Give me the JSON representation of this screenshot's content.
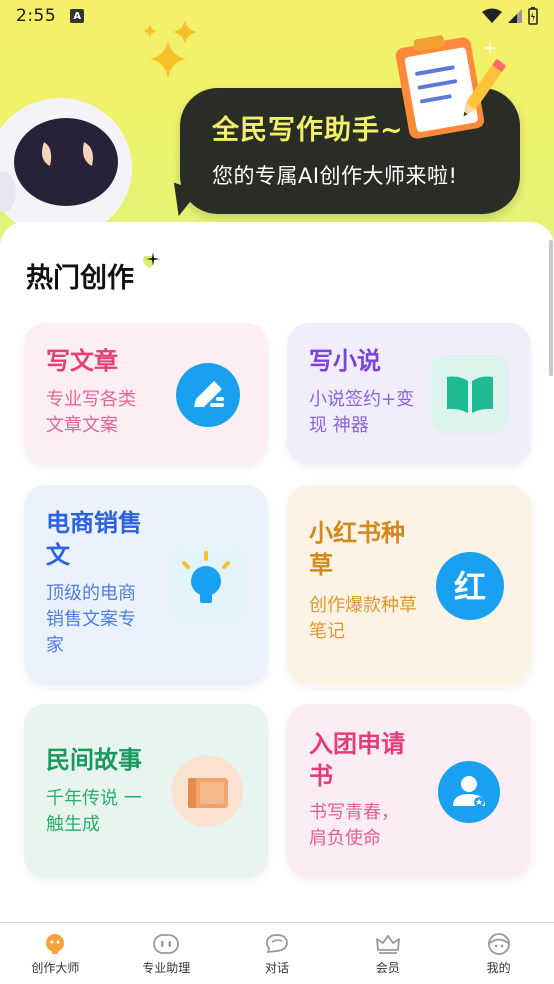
{
  "status_bar": {
    "time": "2:55",
    "a_badge": "A"
  },
  "banner": {
    "title": "全民写作助手~",
    "subtitle": "您的专属AI创作大师来啦!"
  },
  "section": {
    "title": "热门创作"
  },
  "tiles": [
    {
      "title": "写文章",
      "desc": "专业写各类文章文案",
      "icon": "pen-icon",
      "bg": "#fdeef2",
      "title_color": "#e53f78",
      "desc_color": "#e0669a",
      "icon_bg": "#1aa0f0"
    },
    {
      "title": "写小说",
      "desc": "小说签约+变现 神器",
      "icon": "book-icon",
      "bg": "#f2edfb",
      "title_color": "#7a42e0",
      "desc_color": "#8b63d8",
      "icon_bg": "#ddf3ee"
    },
    {
      "title": "电商销售文",
      "desc": "顶级的电商销售文案专家",
      "icon": "lightbulb-icon",
      "bg": "#ecf2fd",
      "title_color": "#2a62e0",
      "desc_color": "#4d7fe0",
      "icon_bg": "#e4f4fd"
    },
    {
      "title": "小红书种草",
      "desc": "创作爆款种草笔记",
      "icon": "red-book-icon",
      "bg": "#fcf3e6",
      "title_color": "#d4881c",
      "desc_color": "#e0962c",
      "icon_bg": "#1aa0f0"
    },
    {
      "title": "民间故事",
      "desc": "千年传说 一触生成",
      "icon": "storybook-icon",
      "bg": "#e8f5ef",
      "title_color": "#179a5c",
      "desc_color": "#2aae6c",
      "icon_bg": "#fbe2d0"
    },
    {
      "title": "入团申请书",
      "desc": "书写青春，肩负使命",
      "icon": "member-badge-icon",
      "bg": "#fcedf4",
      "title_color": "#e23d7a",
      "desc_color": "#e85d92",
      "icon_bg": "#1aa0f0"
    }
  ],
  "nav": [
    {
      "label": "创作大师",
      "icon": "bulb-mascot-icon",
      "active": true
    },
    {
      "label": "专业助理",
      "icon": "robot-face-icon",
      "active": false
    },
    {
      "label": "对话",
      "icon": "chat-bubble-icon",
      "active": false
    },
    {
      "label": "会员",
      "icon": "crown-icon",
      "active": false
    },
    {
      "label": "我的",
      "icon": "profile-face-icon",
      "active": false
    }
  ]
}
